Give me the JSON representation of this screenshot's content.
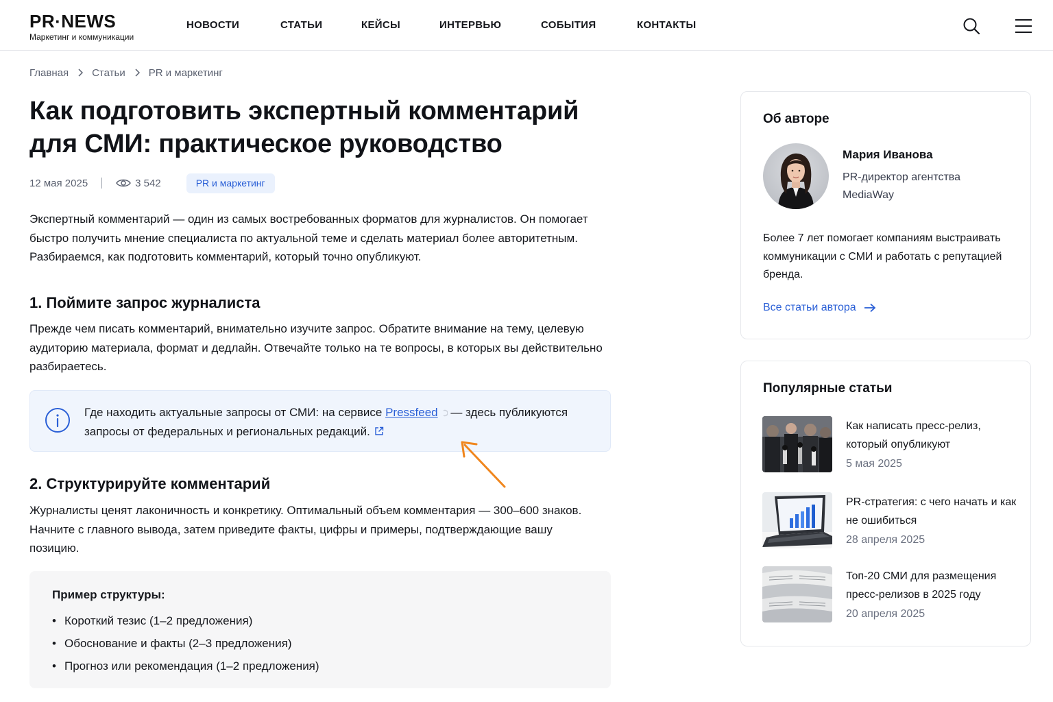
{
  "header": {
    "logo_main": "PR·NEWS",
    "logo_sub": "Маркетинг и коммуникации",
    "nav": [
      "НОВОСТИ",
      "СТАТЬИ",
      "КЕЙСЫ",
      "ИНТЕРВЬЮ",
      "СОБЫТИЯ",
      "КОНТАКТЫ"
    ],
    "icons": [
      "search-icon",
      "menu-icon"
    ]
  },
  "breadcrumb": [
    "Главная",
    "Статьи",
    "PR и маркетинг"
  ],
  "article": {
    "title": "Как подготовить экспертный комментарий для СМИ: практическое руководство",
    "date": "12 мая 2025",
    "views": "3 542",
    "tag": "PR и маркетинг",
    "intro": "Экспертный комментарий — один из самых востребованных форматов для журналистов. Он помогает быстро получить мнение специалиста по актуальной теме и сделать материал более авторитетным. Разбираемся, как подготовить комментарий, который точно опубликуют.",
    "section1_title": "1. Поймите запрос журналиста",
    "section1_text": "Прежде чем писать комментарий, внимательно изучите запрос. Обратите внимание на тему, целевую аудиторию материала, формат и дедлайн. Отвечайте только на те вопросы, в которых вы действительно разбираетесь.",
    "info_prefix": "Где находить актуальные запросы от СМИ: на сервисе ",
    "info_link": "Pressfeed",
    "info_suffix": " — здесь публикуются запросы от федеральных и региональных редакций.",
    "section2_title": "2. Структурируйте комментарий",
    "section2_text": "Журналисты ценят лаконичность и конкретику. Оптимальный объем комментария — 300–600 знаков. Начните с главного вывода, затем приведите факты, цифры и примеры, подтверждающие вашу позицию.",
    "example_title": "Пример структуры:",
    "example_items": [
      "Короткий тезис (1–2 предложения)",
      "Обоснование и факты (2–3 предложения)",
      "Прогноз или рекомендация (1–2 предложения)"
    ]
  },
  "author": {
    "card_title": "Об авторе",
    "name": "Мария Иванова",
    "role": "PR-директор агентства MediaWay",
    "bio": "Более 7 лет помогает компаниям выстраивать коммуникации с СМИ и работать с репутацией бренда.",
    "link": "Все статьи автора"
  },
  "popular": {
    "card_title": "Популярные статьи",
    "items": [
      {
        "title": "Как написать пресс-релиз, который опубликуют",
        "date": "5 мая 2025"
      },
      {
        "title": "PR-стратегия: с чего начать и как не ошибиться",
        "date": "28 апреля 2025"
      },
      {
        "title": "Топ-20 СМИ для размещения пресс-релизов в 2025 году",
        "date": "20 апреля 2025"
      }
    ]
  },
  "colors": {
    "accent": "#2a5fd6",
    "arrow": "#f0861d",
    "info_bg": "#f0f5fd",
    "tag_bg": "#eaf1fd"
  }
}
